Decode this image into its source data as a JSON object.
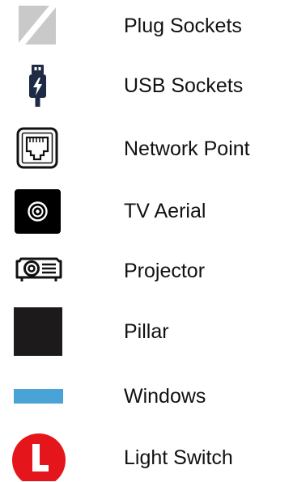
{
  "legend": {
    "items": [
      {
        "label": "Plug Sockets",
        "icon": "plug-socket-swatch-icon",
        "color": "#cccccc"
      },
      {
        "label": "USB Sockets",
        "icon": "usb-plug-icon",
        "color": "#1f2a44"
      },
      {
        "label": "Network Point",
        "icon": "network-port-icon",
        "color": "#111111"
      },
      {
        "label": "TV Aerial",
        "icon": "tv-aerial-socket-icon",
        "color": "#000000"
      },
      {
        "label": "Projector",
        "icon": "projector-icon",
        "color": "#111111"
      },
      {
        "label": "Pillar",
        "icon": "pillar-square-icon",
        "color": "#1c1a1a"
      },
      {
        "label": "Windows",
        "icon": "window-bar-icon",
        "color": "#4aa3d6"
      },
      {
        "label": "Light Switch",
        "icon": "light-switch-l-icon",
        "color": "#e4161c"
      }
    ]
  }
}
